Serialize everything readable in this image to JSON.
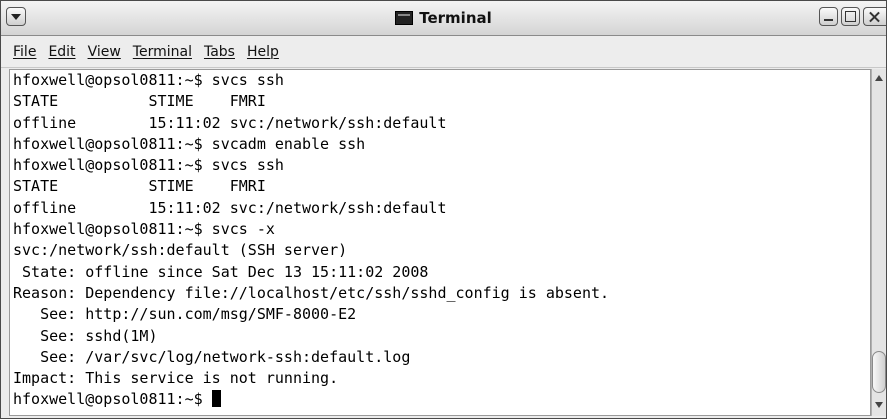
{
  "window": {
    "title": "Terminal",
    "title_icon": "terminal-icon",
    "controls": [
      "minimize-icon",
      "maximize-icon",
      "close-icon"
    ]
  },
  "menubar": {
    "items": [
      "File",
      "Edit",
      "View",
      "Terminal",
      "Tabs",
      "Help"
    ]
  },
  "terminal": {
    "lines": [
      "hfoxwell@opsol0811:~$ svcs ssh",
      "STATE          STIME    FMRI",
      "offline        15:11:02 svc:/network/ssh:default",
      "hfoxwell@opsol0811:~$ svcadm enable ssh",
      "hfoxwell@opsol0811:~$ svcs ssh",
      "STATE          STIME    FMRI",
      "offline        15:11:02 svc:/network/ssh:default",
      "hfoxwell@opsol0811:~$ svcs -x",
      "svc:/network/ssh:default (SSH server)",
      " State: offline since Sat Dec 13 15:11:02 2008",
      "Reason: Dependency file://localhost/etc/ssh/sshd_config is absent.",
      "   See: http://sun.com/msg/SMF-8000-E2",
      "   See: sshd(1M)",
      "   See: /var/svc/log/network-ssh:default.log",
      "Impact: This service is not running."
    ],
    "prompt": "hfoxwell@opsol0811:~$ "
  },
  "colors": {
    "background": "#ffffff",
    "text": "#000000",
    "chrome": "#ececec"
  }
}
